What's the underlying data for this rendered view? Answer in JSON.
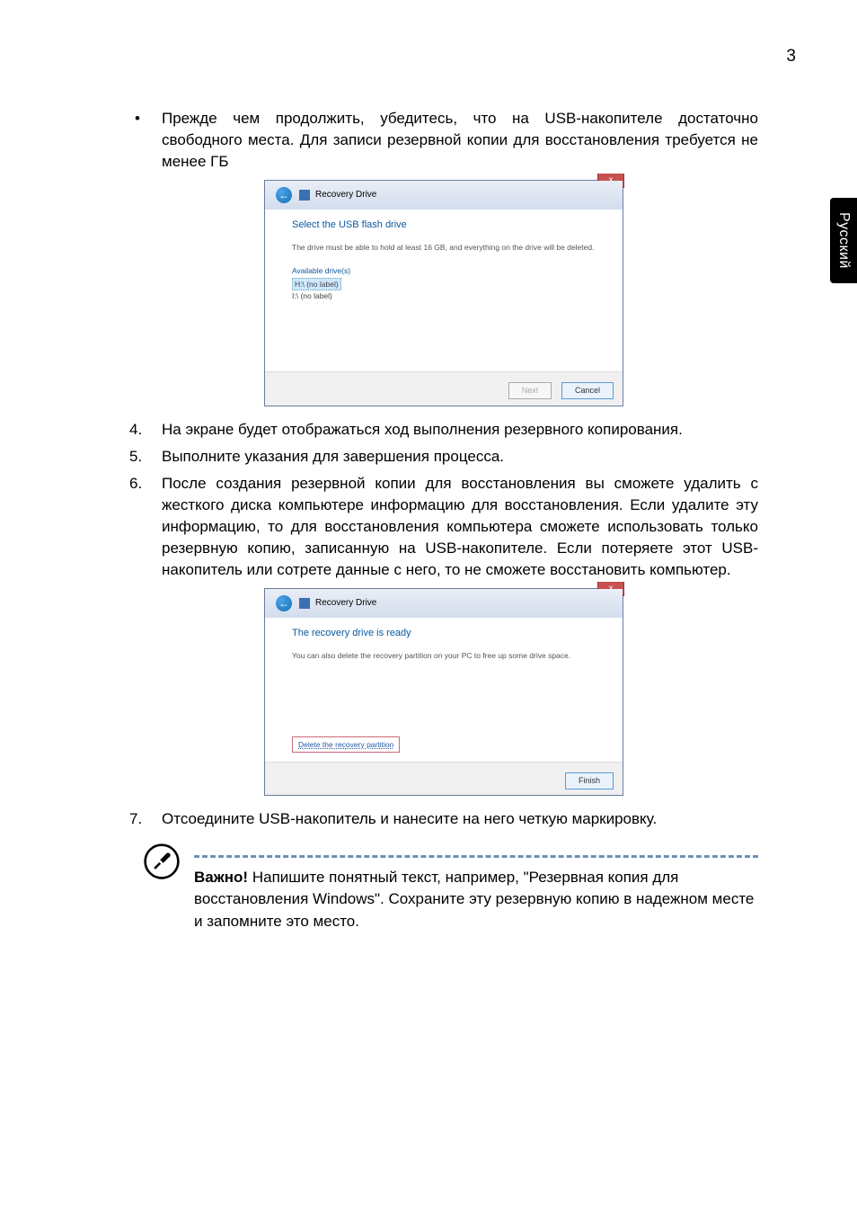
{
  "pageNumber": "3",
  "sideTab": "Русский",
  "bullet1": "Прежде чем продолжить, убедитесь, что на USB-накопителе достаточно свободного места. Для записи резервной копии для восстановления требуется не менее   ГБ",
  "dialog1": {
    "closeGlyph": "x",
    "backGlyph": "←",
    "windowTitle": "Recovery Drive",
    "heading": "Select the USB flash drive",
    "desc": "The drive must be able to hold at least 16 GB, and everything on the drive will be deleted.",
    "availLabel": "Available drive(s)",
    "drive1": "H:\\ (no label)",
    "drive2": "I:\\ (no label)",
    "next": "Next",
    "cancel": "Cancel"
  },
  "item4": "На экране будет отображаться ход выполнения резервного копирования.",
  "item5": "Выполните указания для завершения процесса.",
  "item6": "После создания резервной копии для восстановления вы сможете удалить с жесткого диска компьютере информацию для восстановления. Если удалите эту информацию, то для восстановления компьютера сможете использовать только резервную копию, записанную на USB-накопителе. Если потеряете этот USB-накопитель или сотрете данные с него, то не сможете восстановить компьютер.",
  "dialog2": {
    "closeGlyph": "x",
    "backGlyph": "←",
    "windowTitle": "Recovery Drive",
    "heading": "The recovery drive is ready",
    "desc": "You can also delete the recovery partition on your PC to free up some drive space.",
    "deleteLink": "Delete the recovery partition",
    "finish": "Finish"
  },
  "item7": "Отсоедините USB-накопитель и нанесите на него четкую маркировку.",
  "note": {
    "strong": "Важно!",
    "text": " Напишите понятный текст, например, \"Резервная копия для восстановления Windows\". Сохраните эту резервную копию в надежном месте и запомните это место."
  },
  "markers": {
    "dot": "•",
    "n4": "4.",
    "n5": "5.",
    "n6": "6.",
    "n7": "7."
  }
}
